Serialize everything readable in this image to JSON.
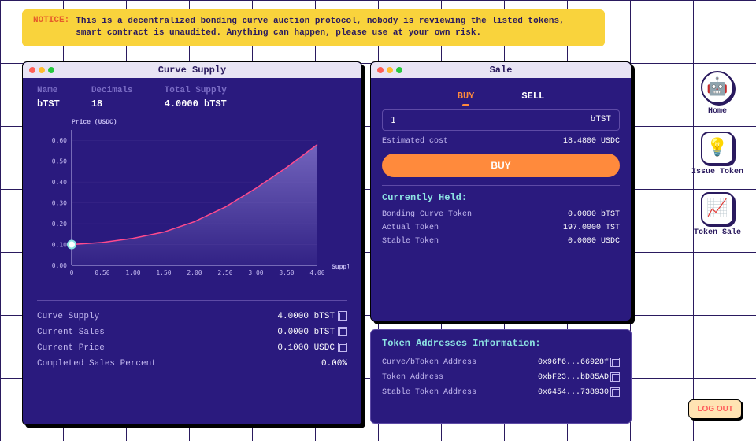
{
  "notice": {
    "label": "NOTICE:",
    "text": "This is a decentralized bonding curve auction protocol, nobody is reviewing the listed tokens, smart contract is unaudited. Anything can happen, please use at your own risk."
  },
  "curve": {
    "title": "Curve Supply",
    "meta": {
      "name_label": "Name",
      "name": "bTST",
      "decimals_label": "Decimals",
      "decimals": "18",
      "supply_label": "Total Supply",
      "supply": "4.0000 bTST"
    },
    "stats": [
      {
        "k": "Curve Supply",
        "v": "4.0000 bTST",
        "copy": true
      },
      {
        "k": "Current Sales",
        "v": "0.0000 bTST",
        "copy": true
      },
      {
        "k": "Current Price",
        "v": "0.1000 USDC",
        "copy": true
      },
      {
        "k": "Completed Sales Percent",
        "v": "0.00%",
        "copy": false
      }
    ]
  },
  "chart_data": {
    "type": "line",
    "title": "",
    "xlabel": "Supply",
    "ylabel": "Price (USDC)",
    "x_ticks": [
      0,
      0.5,
      1.0,
      1.5,
      2.0,
      2.5,
      3.0,
      3.5,
      4.0
    ],
    "y_ticks": [
      0,
      0.1,
      0.2,
      0.3,
      0.4,
      0.5,
      0.6
    ],
    "xlim": [
      0,
      4.0
    ],
    "ylim": [
      0,
      0.65
    ],
    "series": [
      {
        "name": "price",
        "x": [
          0,
          0.5,
          1.0,
          1.5,
          2.0,
          2.5,
          3.0,
          3.5,
          4.0
        ],
        "y": [
          0.1,
          0.11,
          0.13,
          0.16,
          0.21,
          0.28,
          0.37,
          0.47,
          0.58
        ]
      }
    ],
    "marker": {
      "x": 0,
      "y": 0.1
    }
  },
  "sale": {
    "title": "Sale",
    "tabs": {
      "buy": "BUY",
      "sell": "SELL"
    },
    "input_value": "1",
    "input_unit": "bTST",
    "est_label": "Estimated cost",
    "est_value": "18.4800 USDC",
    "buy_btn": "BUY",
    "held_title": "Currently Held:",
    "held": [
      {
        "k": "Bonding Curve Token",
        "v": "0.0000 bTST"
      },
      {
        "k": "Actual Token",
        "v": "197.0000 TST"
      },
      {
        "k": "Stable Token",
        "v": "0.0000 USDC"
      }
    ]
  },
  "addresses": {
    "title": "Token Addresses Information:",
    "rows": [
      {
        "k": "Curve/bToken Address",
        "v": "0x96f6...66928f"
      },
      {
        "k": "Token Address",
        "v": "0xbF23...bD85AD"
      },
      {
        "k": "Stable Token Address",
        "v": "0x6454...738930"
      }
    ]
  },
  "sidebar": [
    {
      "label": "Home",
      "icon": "🤖",
      "round": true
    },
    {
      "label": "Issue Token",
      "icon": "💡",
      "round": false
    },
    {
      "label": "Token Sale",
      "icon": "📈",
      "round": false
    }
  ],
  "logout": "LOG OUT"
}
